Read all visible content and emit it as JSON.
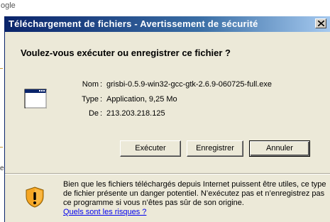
{
  "background": {
    "fragment_text": "ogle"
  },
  "dialog": {
    "title": "Téléchargement de fichiers - Avertissement de sécurité",
    "question": "Voulez-vous exécuter ou enregistrer ce fichier ?",
    "close_icon": "close-icon",
    "file_icon": "application-window-icon",
    "info": {
      "name_label": "Nom",
      "name_value": "grisbi-0.5.9-win32-gcc-gtk-2.6.9-060725-full.exe",
      "type_label": "Type",
      "type_value": "Application, 9,25 Mo",
      "from_label": "De",
      "from_value": "213.203.218.125",
      "separator": ":"
    },
    "buttons": {
      "run": "Exécuter",
      "save": "Enregistrer",
      "cancel": "Annuler"
    },
    "warning": {
      "icon": "security-shield-icon",
      "text": "Bien que les fichiers téléchargés depuis Internet puissent être utiles, ce type de fichier présente un danger potentiel. N’exécutez pas et n’enregistrez pas ce programme si vous n’êtes pas sûr de son origine.",
      "link": "Quels sont les risques ?"
    },
    "colors": {
      "title_gradient_start": "#0a246a",
      "title_gradient_end": "#a6caf0",
      "dialog_bg": "#ece9d8",
      "link": "#0000ee",
      "shield_accent": "#f5a623"
    }
  }
}
